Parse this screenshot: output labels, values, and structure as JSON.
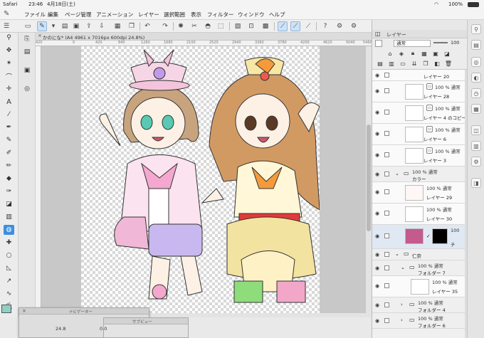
{
  "status": {
    "carrier": "Safari",
    "time": "23:46",
    "date": "4月18日(土)",
    "battery": "100%"
  },
  "menu": [
    "ファイル",
    "編集",
    "ページ管理",
    "アニメーション",
    "レイヤー",
    "選択範囲",
    "表示",
    "フィルター",
    "ウィンドウ",
    "ヘルプ"
  ],
  "canvas": {
    "tab_title": "かのにな* (A4 4961 x 7016px 600dpi 24.8%)",
    "tab_close": "×",
    "ruler_marks": [
      "420",
      "0",
      "420",
      "840",
      "1260",
      "1680",
      "2100",
      "2520",
      "2940",
      "3360",
      "3780",
      "4200",
      "4620",
      "5040",
      "5460"
    ]
  },
  "navigator": {
    "title": "ナビゲーター",
    "close": "×",
    "zoom": "24.8",
    "angle": "0.0"
  },
  "subview": {
    "title": "サブビュー"
  },
  "layer_panel": {
    "title": "レイヤー",
    "blend_mode": "通常",
    "opacity": "100",
    "rows": [
      {
        "type": "layer",
        "name": "レイヤー 20",
        "mode": ""
      },
      {
        "type": "layer",
        "name": "レイヤー 28",
        "mode": "100 % 通常"
      },
      {
        "type": "layer",
        "name": "レイヤー 4 のコピー",
        "mode": "100 % 通常"
      },
      {
        "type": "layer",
        "name": "レイヤー 6",
        "mode": "100 % 通常"
      },
      {
        "type": "layer",
        "name": "レイヤー 3",
        "mode": "100 % 通常"
      },
      {
        "type": "folder",
        "name": "カラー",
        "mode": "100 % 通常"
      },
      {
        "type": "layer",
        "name": "レイヤー 29",
        "mode": "100 % 通常"
      },
      {
        "type": "layer",
        "name": "レイヤー 30",
        "mode": "100 % 通常"
      },
      {
        "type": "mask",
        "name": "チ",
        "mode": "100"
      },
      {
        "type": "folder",
        "name": "仁奈",
        "mode": ""
      },
      {
        "type": "folder",
        "name": "フォルダー 7",
        "mode": "100 % 通常"
      },
      {
        "type": "layer",
        "name": "レイヤー 35",
        "mode": "100 % 通常"
      },
      {
        "type": "folder",
        "name": "フォルダー 4",
        "mode": "100 % 通常"
      },
      {
        "type": "folder",
        "name": "フォルダー 6",
        "mode": "100 % 通常"
      }
    ]
  },
  "colors": {
    "accent": "#3e8ede",
    "main_color": "#8fd0c4"
  }
}
